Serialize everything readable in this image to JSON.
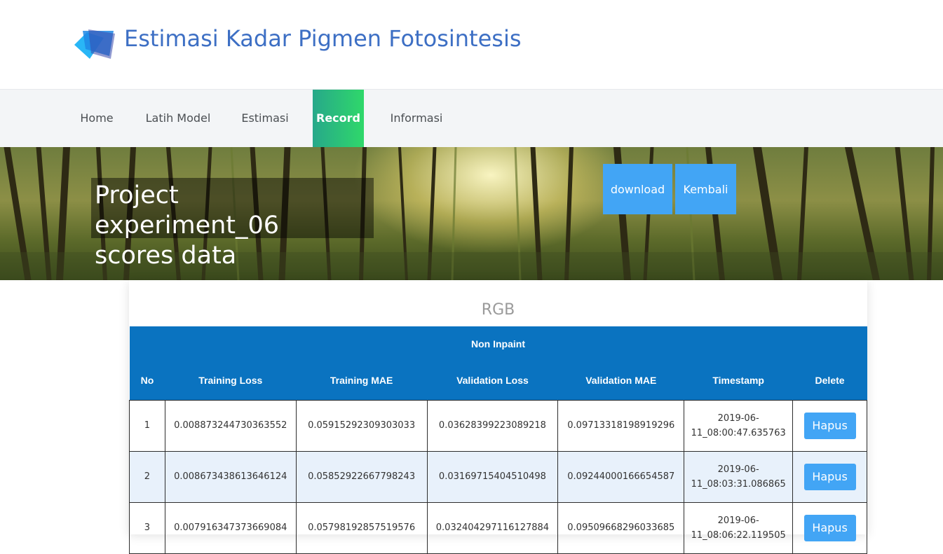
{
  "brand": {
    "title": "Estimasi Kadar Pigmen Fotosintesis",
    "logo_icon": "layers-logo-icon"
  },
  "nav": {
    "items": [
      {
        "label": "Home",
        "active": false
      },
      {
        "label": "Latih Model",
        "active": false
      },
      {
        "label": "Estimasi",
        "active": false
      },
      {
        "label": "Record",
        "active": true
      },
      {
        "label": "Informasi",
        "active": false
      }
    ]
  },
  "hero": {
    "title_line1": "Project experiment_06",
    "title_line2": "scores data",
    "download_label": "download",
    "back_label": "Kembali"
  },
  "card": {
    "title": "RGB",
    "group_header": "Non Inpaint",
    "columns": [
      "No",
      "Training Loss",
      "Training MAE",
      "Validation Loss",
      "Validation MAE",
      "Timestamp",
      "Delete"
    ],
    "rows": [
      {
        "no": "1",
        "training_loss": "0.008873244730363552",
        "training_mae": "0.05915292309303033",
        "validation_loss": "0.03628399223089218",
        "validation_mae": "0.09713318198919296",
        "ts_date": "2019-06-",
        "ts_time": "11_08:00:47.635763",
        "delete_label": "Hapus"
      },
      {
        "no": "2",
        "training_loss": "0.008673438613646124",
        "training_mae": "0.05852922667798243",
        "validation_loss": "0.03169715404510498",
        "validation_mae": "0.09244000166654587",
        "ts_date": "2019-06-",
        "ts_time": "11_08:03:31.086865",
        "delete_label": "Hapus"
      },
      {
        "no": "3",
        "training_loss": "0.007916347373669084",
        "training_mae": "0.05798192857519576",
        "validation_loss": "0.032404297116127884",
        "validation_mae": "0.09509668296033685",
        "ts_date": "2019-06-",
        "ts_time": "11_08:06:22.119505",
        "delete_label": "Hapus"
      }
    ]
  },
  "colors": {
    "brand_blue": "#3d6fc4",
    "nav_active_start": "#27a88a",
    "nav_active_end": "#2fd86a",
    "button_blue": "#42a5f5",
    "table_header": "#0a73c0",
    "row_alt": "#e8f1fb"
  }
}
